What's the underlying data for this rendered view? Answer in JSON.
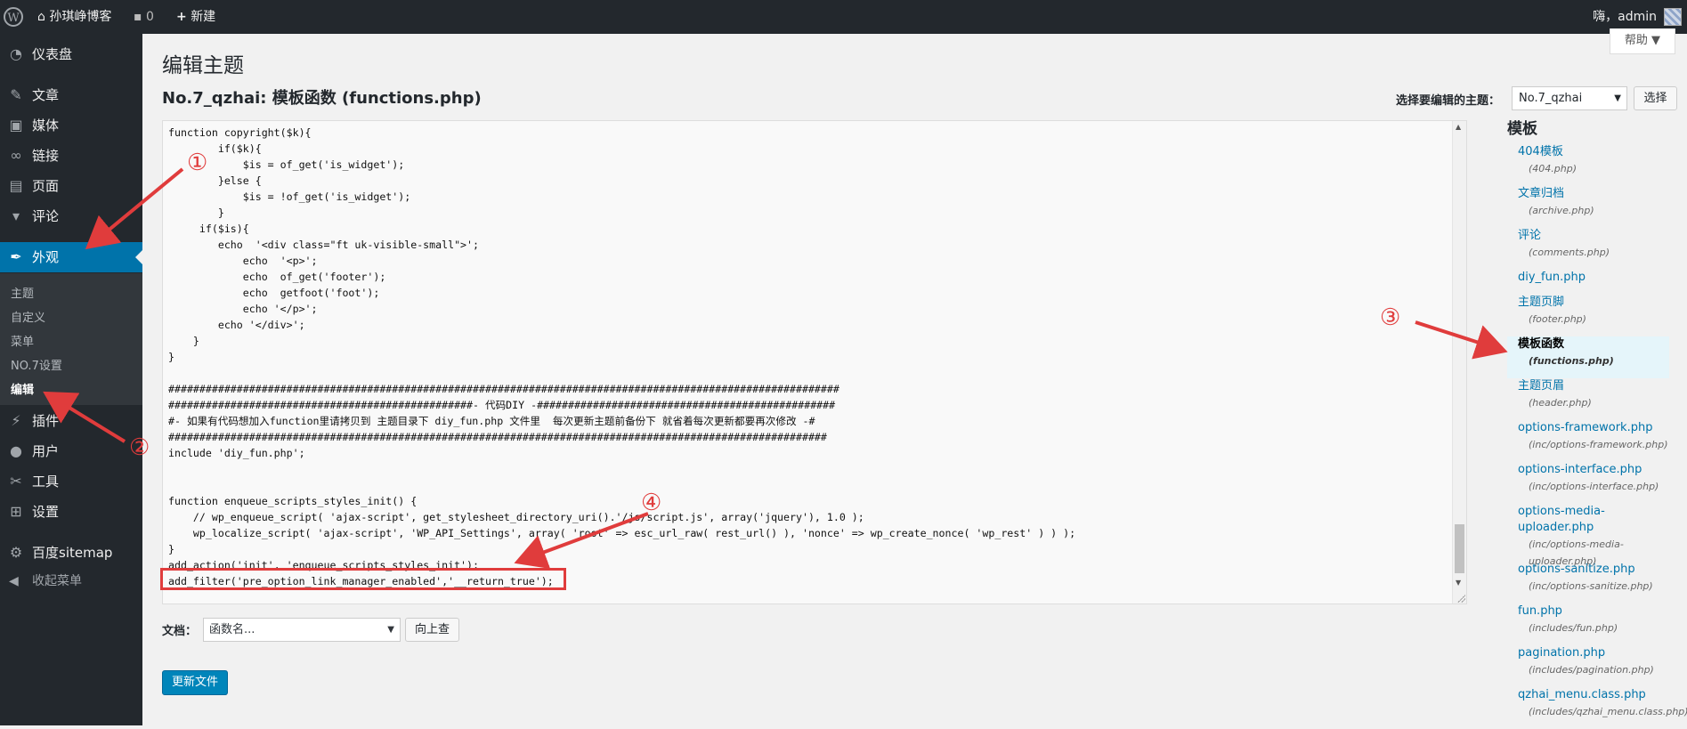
{
  "adminbar": {
    "wp_logo": "wordpress-icon",
    "site_name": "孙琪峥博客",
    "comments_count": "0",
    "new_label": "新建",
    "user_greeting": "嗨，admin"
  },
  "sidebar": {
    "items": [
      {
        "label": "仪表盘",
        "icon": "dashboard-icon"
      },
      {
        "label": "文章",
        "icon": "pin-icon"
      },
      {
        "label": "媒体",
        "icon": "media-icon"
      },
      {
        "label": "链接",
        "icon": "link-icon"
      },
      {
        "label": "页面",
        "icon": "page-icon"
      },
      {
        "label": "评论",
        "icon": "comment-icon"
      },
      {
        "label": "外观",
        "icon": "appearance-icon"
      },
      {
        "label": "插件",
        "icon": "plugin-icon"
      },
      {
        "label": "用户",
        "icon": "user-icon"
      },
      {
        "label": "工具",
        "icon": "tools-icon"
      },
      {
        "label": "设置",
        "icon": "settings-icon"
      },
      {
        "label": "百度sitemap",
        "icon": "gear-icon"
      }
    ],
    "submenu": [
      "主题",
      "自定义",
      "菜单",
      "NO.7设置",
      "编辑"
    ],
    "collapse_label": "收起菜单"
  },
  "help_label": "帮助 ▼",
  "page_title": "编辑主题",
  "file_heading": "No.7_qzhai: 模板函数 (functions.php)",
  "theme_selector": {
    "label": "选择要编辑的主题：",
    "value": "No.7_qzhai",
    "button": "选择"
  },
  "editor": {
    "code": "function copyright($k){\n        if($k){\n            $is = of_get('is_widget');\n        }else {\n            $is = !of_get('is_widget');\n        }\n     if($is){\n        echo  '<div class=\"ft uk-visible-small\">';\n            echo  '<p>';\n            echo  of_get('footer');\n            echo  getfoot('foot');\n            echo '</p>';\n        echo '</div>';\n    }\n}\n\n############################################################################################################\n#################################################- 代码DIY -################################################\n#- 如果有代码想加入function里请拷贝到 主题目录下 diy_fun.php 文件里  每次更新主题前备份下 就省着每次更新都要再次修改 -#\n##########################################################################################################\ninclude 'diy_fun.php';\n\n\nfunction enqueue_scripts_styles_init() {\n    // wp_enqueue_script( 'ajax-script', get_stylesheet_directory_uri().'/js/script.js', array('jquery'), 1.0 );\n    wp_localize_script( 'ajax-script', 'WP_API_Settings', array( 'root' => esc_url_raw( rest_url() ), 'nonce' => wp_create_nonce( 'wp_rest' ) ) );\n}\nadd_action('init', 'enqueue_scripts_styles_init');\nadd_filter('pre_option_link_manager_enabled','__return_true');"
  },
  "documentation": {
    "label": "文档：",
    "select_value": "函数名...",
    "lookup_button": "向上查"
  },
  "update_button": "更新文件",
  "templates": {
    "title": "模板",
    "items": [
      {
        "name": "404模板",
        "file": "(404.php)"
      },
      {
        "name": "文章归档",
        "file": "(archive.php)"
      },
      {
        "name": "评论",
        "file": "(comments.php)"
      },
      {
        "name": "diy_fun.php",
        "file": ""
      },
      {
        "name": "主题页脚",
        "file": "(footer.php)"
      },
      {
        "name": "模板函数",
        "file": "(functions.php)",
        "current": true
      },
      {
        "name": "主题页眉",
        "file": "(header.php)"
      },
      {
        "name": "options-framework.php",
        "file": "(inc/options-framework.php)"
      },
      {
        "name": "options-interface.php",
        "file": "(inc/options-interface.php)"
      },
      {
        "name": "options-media-uploader.php",
        "file": "(inc/options-media-uploader.php)"
      },
      {
        "name": "options-sanitize.php",
        "file": "(inc/options-sanitize.php)"
      },
      {
        "name": "fun.php",
        "file": "(includes/fun.php)"
      },
      {
        "name": "pagination.php",
        "file": "(includes/pagination.php)"
      },
      {
        "name": "qzhai_menu.class.php",
        "file": "(includes/qzhai_menu.class.php)"
      }
    ]
  },
  "annotations": {
    "marks": [
      "①",
      "②",
      "③",
      "④"
    ],
    "color": "#e03c3c"
  },
  "colors": {
    "sidebar_bg": "#23282d",
    "active_menu": "#0073aa",
    "primary_button": "#0085ba"
  }
}
